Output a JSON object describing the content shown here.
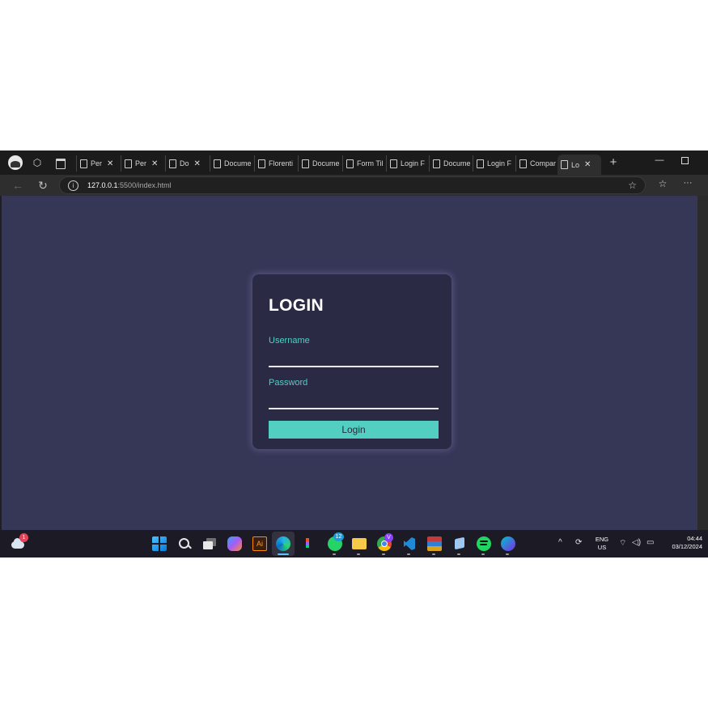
{
  "browser": {
    "tabs": [
      {
        "label": "Per",
        "closable": true
      },
      {
        "label": "Per",
        "closable": true
      },
      {
        "label": "Do",
        "closable": true
      },
      {
        "label": "Docume",
        "closable": false
      },
      {
        "label": "Florenti",
        "closable": false
      },
      {
        "label": "Docume",
        "closable": false
      },
      {
        "label": "Form Til",
        "closable": false
      },
      {
        "label": "Login F",
        "closable": false
      },
      {
        "label": "Docume",
        "closable": false
      },
      {
        "label": "Login F",
        "closable": false
      },
      {
        "label": "Compar",
        "closable": false
      },
      {
        "label": "Lo",
        "closable": true,
        "active": true
      }
    ],
    "url_host": "127.0.0.1",
    "url_path": ":5500/index.html"
  },
  "login": {
    "title": "LOGIN",
    "username_label": "Username",
    "username_value": "",
    "password_label": "Password",
    "password_value": "",
    "button_label": "Login"
  },
  "taskbar": {
    "weather_badge": "1",
    "whatsapp_badge": "12",
    "chrome_badge": "V",
    "language": "ENG",
    "region": "US",
    "time": "04:44",
    "date": "03/12/2024"
  },
  "colors": {
    "page_bg": "#363657",
    "card_bg": "#2a2a45",
    "accent": "#53cfc2",
    "title": "#ffffff"
  }
}
